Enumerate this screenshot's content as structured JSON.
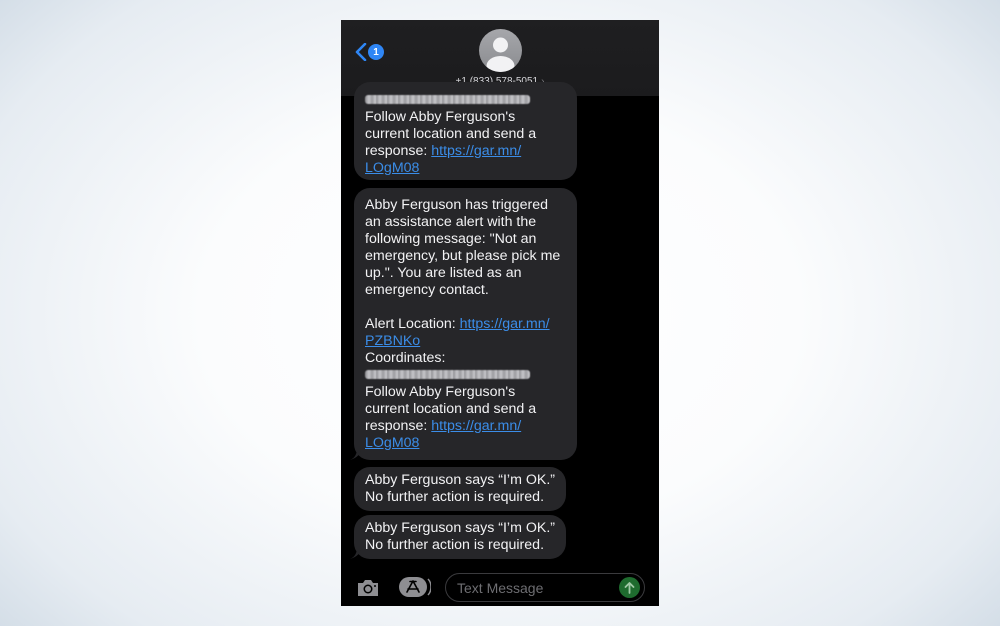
{
  "header": {
    "back_badge": "1",
    "contact_number": "+1 (833) 578-5051",
    "contact_chevron": "›"
  },
  "messages": [
    {
      "id": "partial",
      "lines": [
        {
          "type": "redacted"
        },
        {
          "type": "text",
          "text": "Follow Abby Ferguson's"
        },
        {
          "type": "text",
          "text": "current location and send a"
        },
        {
          "type": "mixed",
          "text": "response: ",
          "link": "https://gar.mn/"
        },
        {
          "type": "link",
          "link": "LOgM08"
        }
      ]
    },
    {
      "id": "alert",
      "lines": [
        "Abby Ferguson has triggered",
        "an assistance alert with the",
        "following message: \"Not an",
        "emergency, but please pick me",
        "up.\". You are listed as an",
        "emergency contact."
      ],
      "alert_location_label": "Alert Location: ",
      "alert_location_link_1": "https://gar.mn/",
      "alert_location_link_2": "PZBNKo",
      "coordinates_label": "Coordinates:",
      "follow_lines": [
        "Follow Abby Ferguson's",
        "current location and send a"
      ],
      "response_label": "response: ",
      "response_link_1": "https://gar.mn/",
      "response_link_2": "LOgM08"
    },
    {
      "id": "ok1",
      "lines": [
        "Abby Ferguson says “I’m OK.”",
        "No further action is required."
      ]
    },
    {
      "id": "ok2",
      "lines": [
        "Abby Ferguson says “I’m OK.”",
        "No further action is required."
      ]
    }
  ],
  "composer": {
    "placeholder": "Text Message",
    "camera_icon": "camera-icon",
    "apps_icon": "app-store-icon",
    "send_icon": "send-arrow-icon",
    "send_color": "#1e6b2e"
  },
  "colors": {
    "link": "#3b8de8",
    "bubble": "#262629",
    "badge": "#2f86f5"
  }
}
